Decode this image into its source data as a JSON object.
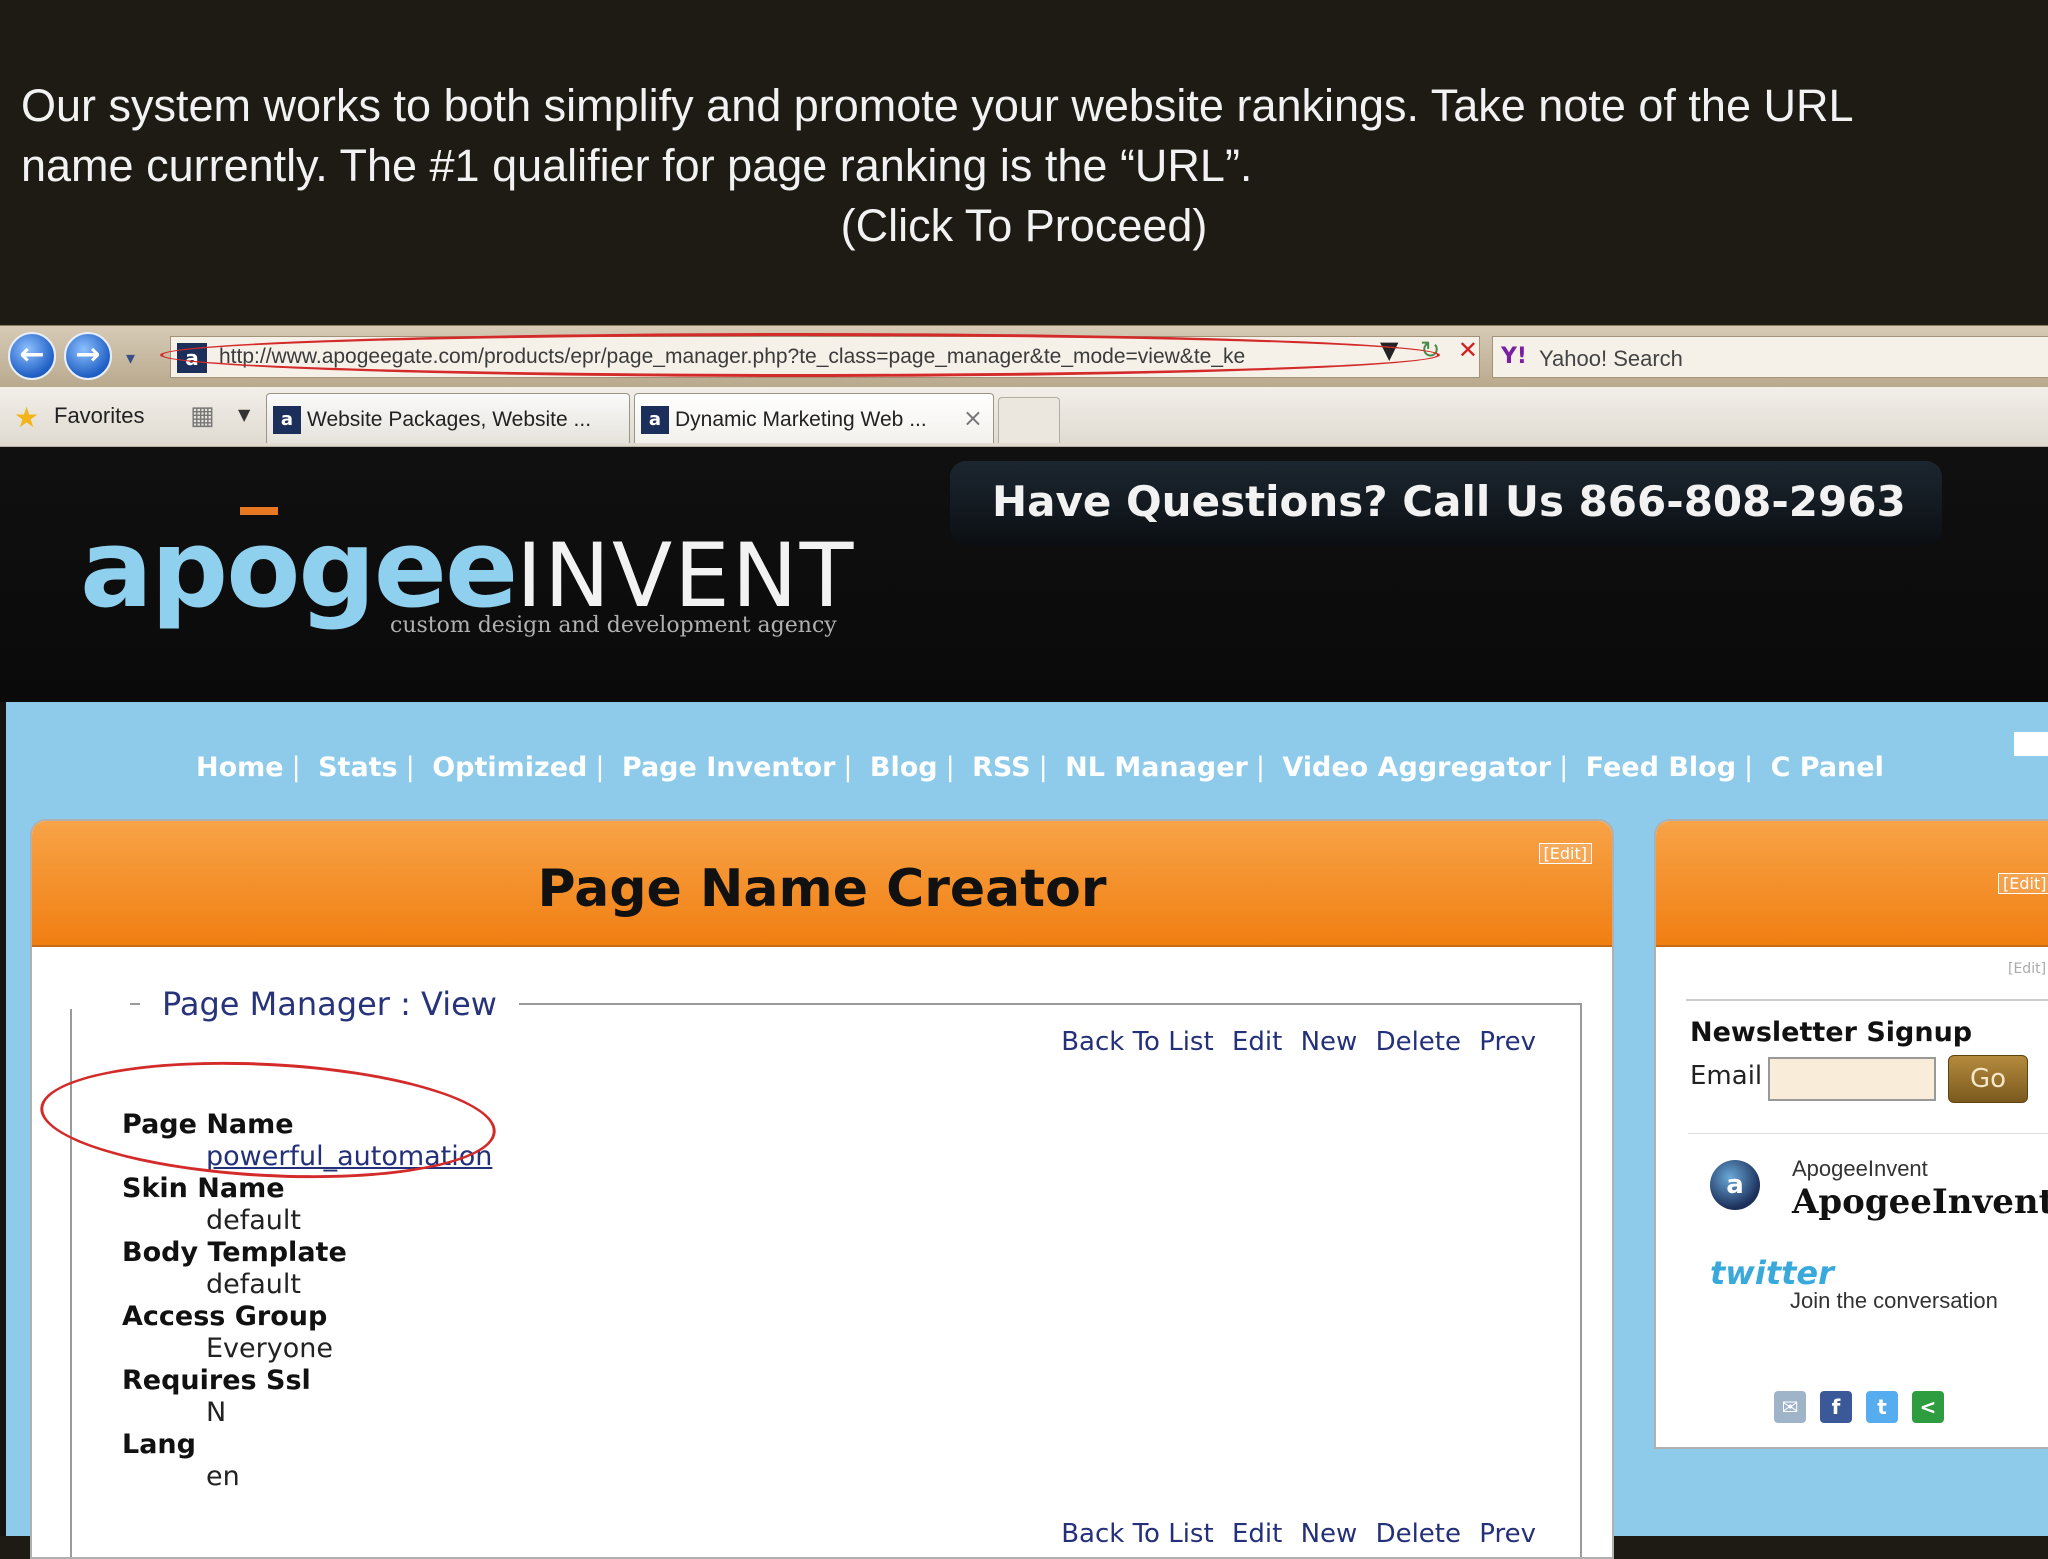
{
  "caption": {
    "line1": "Our system works to both simplify and promote your website rankings. Take note of the URL",
    "line2": "name currently.  The #1 qualifier for page ranking is the “URL”.",
    "line3": "(Click To Proceed)"
  },
  "browser": {
    "url": "http://www.apogeegate.com/products/epr/page_manager.php?te_class=page_manager&te_mode=view&te_ke",
    "search_placeholder": "Yahoo! Search",
    "favorites_label": "Favorites",
    "tabs": [
      {
        "label": "Website Packages, Website ..."
      },
      {
        "label": "Dynamic Marketing Web ..."
      }
    ]
  },
  "site": {
    "logo_main": "apogee",
    "logo_sub": "INVENT",
    "tagline": "custom design and development agency",
    "phone_banner": "Have Questions? Call Us  866-808-2963",
    "nav": [
      "Home",
      "Stats",
      "Optimized",
      "Page Inventor",
      "Blog",
      "RSS",
      "NL Manager",
      "Video Aggregator",
      "Feed Blog",
      "C Panel"
    ]
  },
  "main": {
    "title": "Page Name Creator",
    "edit_label": "[Edit]",
    "legend": "Page Manager : View",
    "actions": [
      "Back To List",
      "Edit",
      "New",
      "Delete",
      "Prev"
    ],
    "fields": [
      {
        "label": "Page Name",
        "value": "powerful_automation"
      },
      {
        "label": "Skin Name",
        "value": "default"
      },
      {
        "label": "Body Template",
        "value": "default"
      },
      {
        "label": "Access Group",
        "value": "Everyone"
      },
      {
        "label": "Requires Ssl",
        "value": "N"
      },
      {
        "label": "Lang",
        "value": "en"
      }
    ]
  },
  "sidebar": {
    "edit_label": "[Edit]",
    "newsletter_title": "Newsletter Signup",
    "email_label": "Email",
    "email_value": "",
    "go_label": "Go",
    "twitter_handle": "ApogeeInvent",
    "twitter_name": "ApogeeInvent",
    "twitter_logo": "twitter",
    "twitter_tagline": "Join the conversation"
  },
  "colors": {
    "accent_orange": "#f17f12",
    "nav_blue": "#8ecbea",
    "link_navy": "#24307a",
    "highlight_red": "#d32a2a"
  }
}
